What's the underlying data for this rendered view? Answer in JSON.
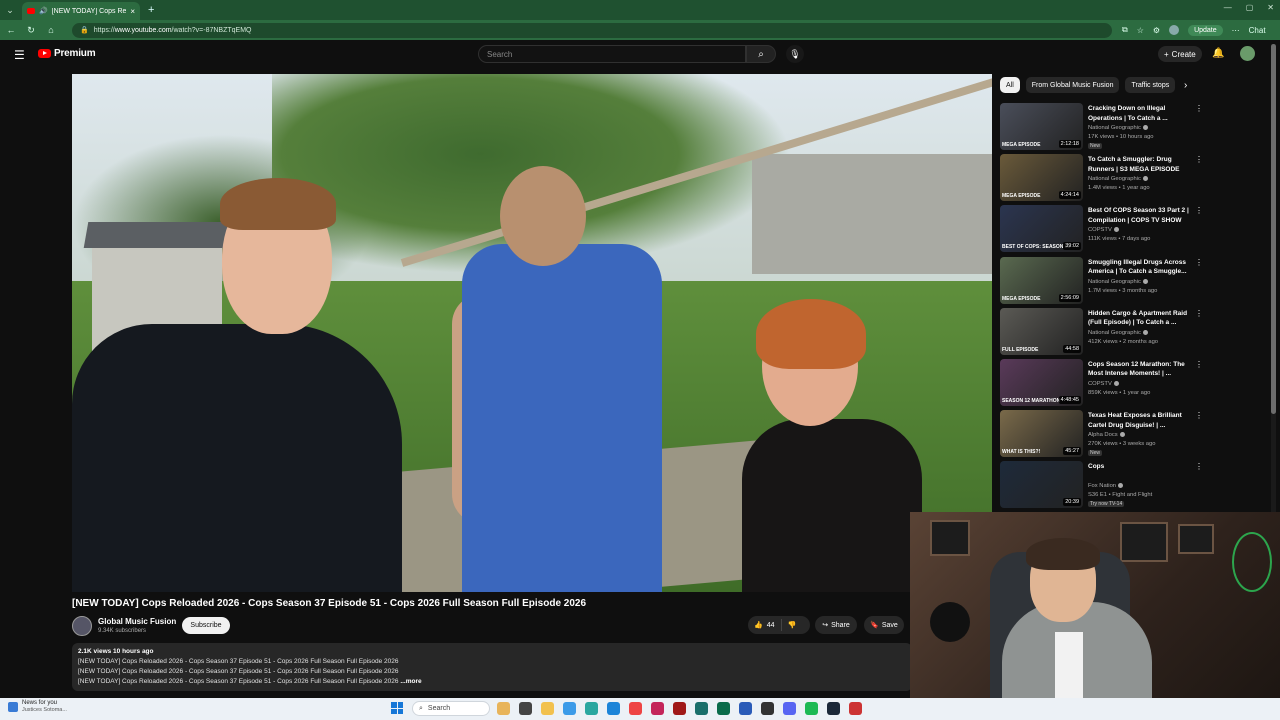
{
  "browser": {
    "tab_title": "[NEW TODAY] Cops Reloaded",
    "url_prefix": "https://",
    "url_host": "www.youtube.com",
    "url_path": "/watch?v=-87NBZTqEMQ",
    "update_label": "Update",
    "chat_label": "Chat"
  },
  "header": {
    "logo_text": "Premium",
    "search_placeholder": "Search",
    "create_label": "Create"
  },
  "video": {
    "overlay_text": "FO",
    "title": "[NEW TODAY] Cops Reloaded 2026 - Cops Season 37 Episode 51 - Cops 2026 Full Season Full Episode 2026",
    "channel_name": "Global Music Fusion",
    "subscribers": "9.34K subscribers",
    "subscribe_label": "Subscribe",
    "likes": "44",
    "share_label": "Share",
    "save_label": "Save",
    "views_time": "2.1K views  10 hours ago",
    "description_lines": [
      "[NEW TODAY] Cops Reloaded 2026 - Cops Season 37 Episode 51 - Cops 2026 Full Season Full Episode 2026",
      "[NEW TODAY] Cops Reloaded 2026 - Cops Season 37 Episode 51 - Cops 2026 Full Season Full Episode 2026",
      "[NEW TODAY] Cops Reloaded 2026 - Cops Season 37 Episode 51 - Cops 2026 Full Season Full Episode 2026"
    ],
    "more_label": "...more"
  },
  "chips": [
    "All",
    "From Global Music Fusion",
    "Traffic stops"
  ],
  "recommendations": [
    {
      "title": "Cracking Down on Illegal Operations | To Catch a ...",
      "channel": "National Geographic",
      "meta": "17K views • 10 hours ago",
      "badge": "New",
      "duration": "2:12:18",
      "thumb_color": "#4a4e5a",
      "thumb_label": "MEGA EPISODE"
    },
    {
      "title": "To Catch a Smuggler: Drug Runners | S3 MEGA EPISODE",
      "channel": "National Geographic",
      "meta": "1.4M views • 1 year ago",
      "badge": "",
      "duration": "4:24:14",
      "thumb_color": "#6a5a3a",
      "thumb_label": "MEGA EPISODE"
    },
    {
      "title": "Best Of COPS Season 33 Part 2 | Compilation | COPS TV SHOW",
      "channel": "COPSTV",
      "meta": "111K views • 7 days ago",
      "badge": "",
      "duration": "39:02",
      "thumb_color": "#2b3550",
      "thumb_label": "BEST OF COPS: SEASON 33"
    },
    {
      "title": "Smuggling Illegal Drugs Across America | To Catch a Smuggle...",
      "channel": "National Geographic",
      "meta": "1.7M views • 3 months ago",
      "badge": "",
      "duration": "2:56:09",
      "thumb_color": "#5a6a50",
      "thumb_label": "MEGA EPISODE"
    },
    {
      "title": "Hidden Cargo & Apartment Raid (Full Episode) | To Catch a ...",
      "channel": "National Geographic",
      "meta": "412K views • 2 months ago",
      "badge": "",
      "duration": "44:58",
      "thumb_color": "#5b5a55",
      "thumb_label": "FULL EPISODE"
    },
    {
      "title": "Cops Season 12 Marathon: The Most Intense Moments! | ...",
      "channel": "COPSTV",
      "meta": "859K views • 1 year ago",
      "badge": "",
      "duration": "4:48:45",
      "thumb_color": "#5a3a5a",
      "thumb_label": "SEASON 12 MARATHON"
    },
    {
      "title": "Texas Heat Exposes a Brilliant Cartel Drug Disguise! | ...",
      "channel": "Alpha Docs",
      "meta": "270K views • 3 weeks ago",
      "badge": "New",
      "duration": "45:27",
      "thumb_color": "#7a6a4a",
      "thumb_label": "WHAT IS THIS?!"
    },
    {
      "title": "Cops",
      "channel": "Fox Nation",
      "meta": "S36 E1 • Fight and Flight",
      "badge": "Try now  TV-14",
      "duration": "20:39",
      "thumb_color": "#1e2a3a",
      "thumb_label": ""
    }
  ],
  "taskbar": {
    "news_title": "News for you",
    "news_sub": "Justices Sotoma...",
    "search_label": "Search"
  }
}
